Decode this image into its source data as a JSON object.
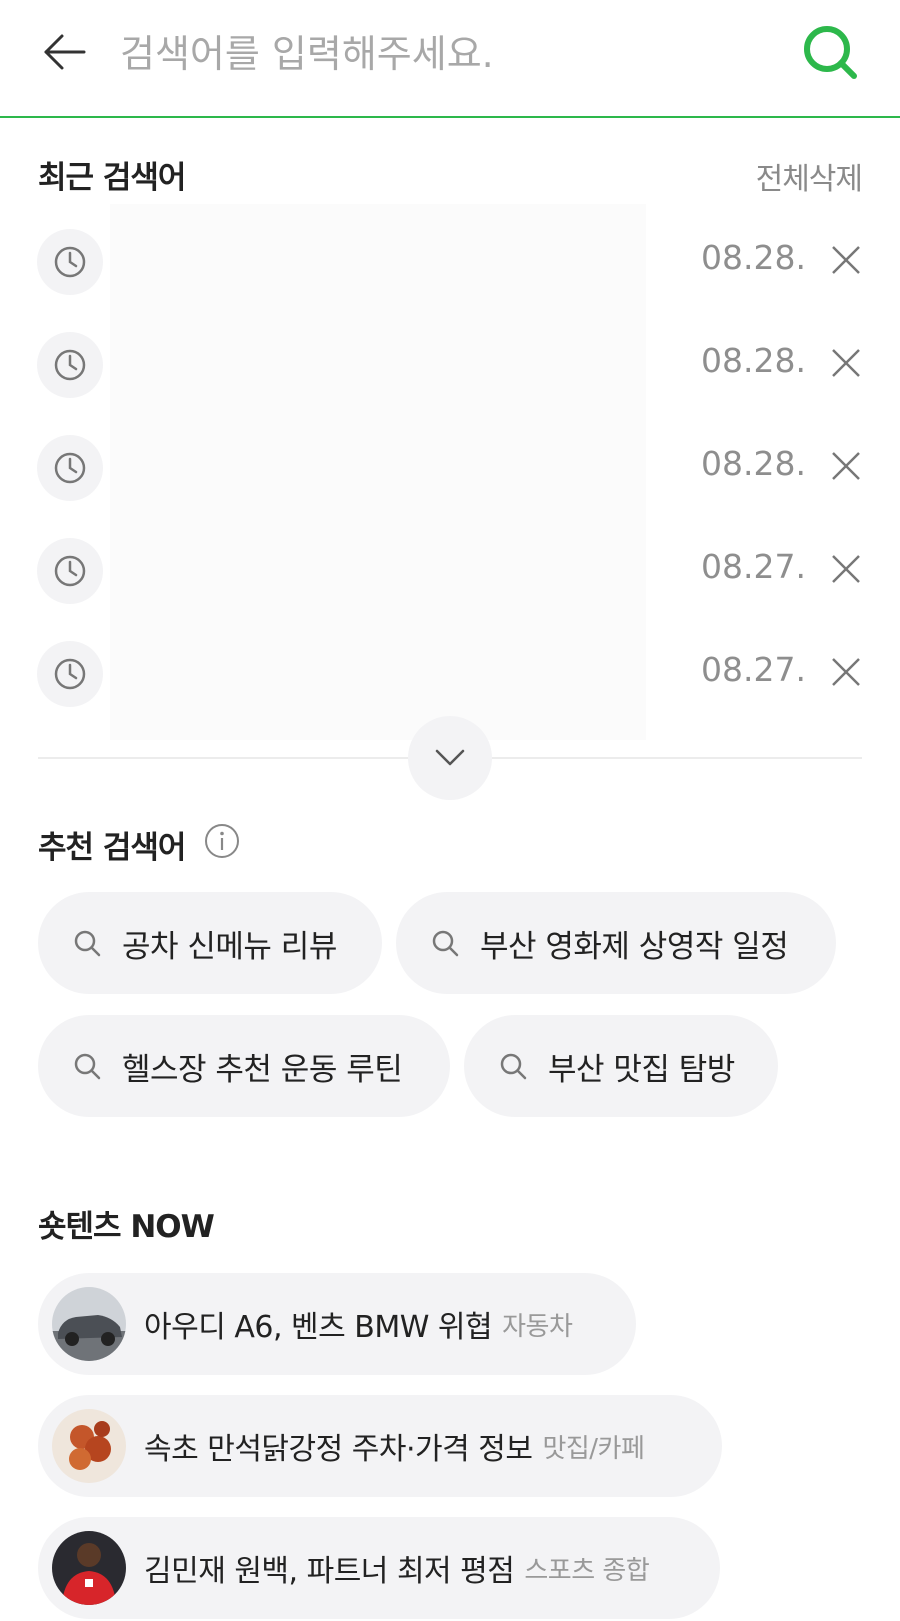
{
  "search": {
    "placeholder": "검색어를 입력해주세요."
  },
  "recent": {
    "title": "최근 검색어",
    "clear_all": "전체삭제",
    "items": [
      {
        "text": "",
        "date": "08.28."
      },
      {
        "text": "",
        "date": "08.28."
      },
      {
        "text": "",
        "date": "08.28."
      },
      {
        "text": "",
        "date": "08.27."
      },
      {
        "text": "",
        "date": "08.27."
      }
    ]
  },
  "recommended": {
    "title": "추천 검색어",
    "items": [
      {
        "label": "공차 신메뉴 리뷰"
      },
      {
        "label": "부산 영화제 상영작 일정"
      },
      {
        "label": "헬스장 추천 운동 루틴"
      },
      {
        "label": "부산 맛집 탐방"
      }
    ]
  },
  "shortents": {
    "title": "숏텐츠 NOW",
    "items": [
      {
        "title": "아우디 A6, 벤츠 BMW 위협",
        "category": "자동차"
      },
      {
        "title": "속초 만석닭강정 주차·가격 정보",
        "category": "맛집/카페"
      },
      {
        "title": "김민재 원백, 파트너 최저 평점",
        "category": "스포츠 종합"
      }
    ]
  },
  "colors": {
    "accent": "#2db84b",
    "chip_bg": "#f3f3f5",
    "muted_text": "#8e8e8e"
  }
}
